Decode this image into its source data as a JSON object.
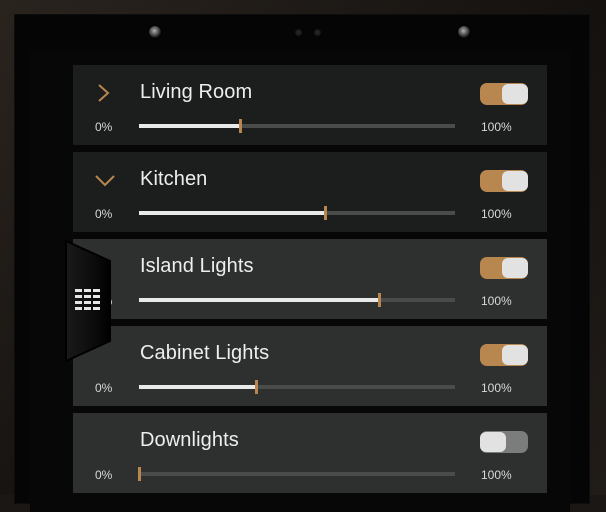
{
  "accent_color": "#b8874f",
  "rooms": [
    {
      "name": "Living Room",
      "min_label": "0%",
      "max_label": "100%",
      "level": 0.32,
      "on": true,
      "icon": "chevron-right-icon"
    },
    {
      "name": "Kitchen",
      "min_label": "0%",
      "max_label": "100%",
      "level": 0.59,
      "on": true,
      "icon": "chevron-down-icon"
    }
  ],
  "zones": [
    {
      "name": "Island Lights",
      "min_label": "0%",
      "max_label": "100%",
      "level": 0.76,
      "on": true
    },
    {
      "name": "Cabinet Lights",
      "min_label": "0%",
      "max_label": "100%",
      "level": 0.37,
      "on": true
    },
    {
      "name": "Downlights",
      "min_label": "0%",
      "max_label": "100%",
      "level": 0.0,
      "on": false
    }
  ],
  "side_tab": {
    "icon": "grid-menu-icon"
  }
}
